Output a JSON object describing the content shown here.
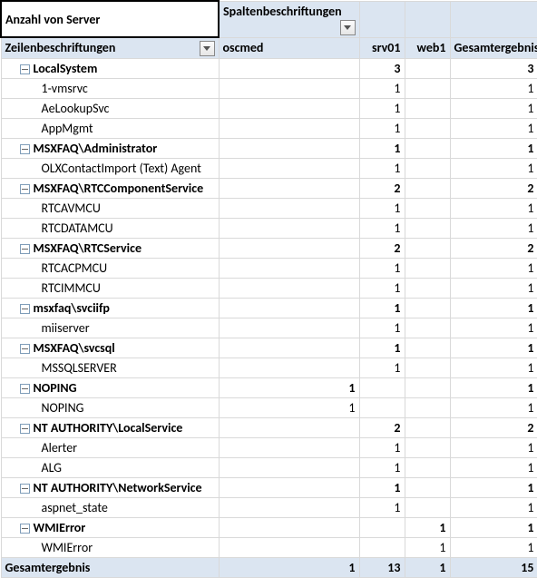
{
  "header": {
    "value_field": "Anzahl von Server",
    "col_labels": "Spaltenbeschriftungen",
    "row_labels": "Zeilenbeschriftungen",
    "grand_total": "Gesamtergebnis"
  },
  "columns": [
    "oscmed",
    "srv01",
    "web1",
    "Gesamtergebnis"
  ],
  "rows": [
    {
      "lvl": 1,
      "expand": true,
      "bold": true,
      "label": "LocalSystem",
      "v": [
        "",
        "3",
        "",
        "3"
      ]
    },
    {
      "lvl": 2,
      "label": "1-vmsrvc",
      "v": [
        "",
        "1",
        "",
        "1"
      ]
    },
    {
      "lvl": 2,
      "label": "AeLookupSvc",
      "v": [
        "",
        "1",
        "",
        "1"
      ]
    },
    {
      "lvl": 2,
      "label": "AppMgmt",
      "v": [
        "",
        "1",
        "",
        "1"
      ]
    },
    {
      "lvl": 1,
      "expand": true,
      "bold": true,
      "label": "MSXFAQ\\Administrator",
      "v": [
        "",
        "1",
        "",
        "1"
      ]
    },
    {
      "lvl": 2,
      "label": "OLXContactImport (Text) Agent",
      "v": [
        "",
        "1",
        "",
        "1"
      ]
    },
    {
      "lvl": 1,
      "expand": true,
      "bold": true,
      "label": "MSXFAQ\\RTCComponentService",
      "v": [
        "",
        "2",
        "",
        "2"
      ]
    },
    {
      "lvl": 2,
      "label": "RTCAVMCU",
      "v": [
        "",
        "1",
        "",
        "1"
      ]
    },
    {
      "lvl": 2,
      "label": "RTCDATAMCU",
      "v": [
        "",
        "1",
        "",
        "1"
      ]
    },
    {
      "lvl": 1,
      "expand": true,
      "bold": true,
      "label": "MSXFAQ\\RTCService",
      "v": [
        "",
        "2",
        "",
        "2"
      ]
    },
    {
      "lvl": 2,
      "label": "RTCACPMCU",
      "v": [
        "",
        "1",
        "",
        "1"
      ]
    },
    {
      "lvl": 2,
      "label": "RTCIMMCU",
      "v": [
        "",
        "1",
        "",
        "1"
      ]
    },
    {
      "lvl": 1,
      "expand": true,
      "bold": true,
      "label": "msxfaq\\svciifp",
      "v": [
        "",
        "1",
        "",
        "1"
      ]
    },
    {
      "lvl": 2,
      "label": "miiserver",
      "v": [
        "",
        "1",
        "",
        "1"
      ]
    },
    {
      "lvl": 1,
      "expand": true,
      "bold": true,
      "label": "MSXFAQ\\svcsql",
      "v": [
        "",
        "1",
        "",
        "1"
      ]
    },
    {
      "lvl": 2,
      "label": "MSSQLSERVER",
      "v": [
        "",
        "1",
        "",
        "1"
      ]
    },
    {
      "lvl": 1,
      "expand": true,
      "bold": true,
      "label": "NOPING",
      "v": [
        "1",
        "",
        "",
        "1"
      ]
    },
    {
      "lvl": 2,
      "label": "NOPING",
      "v": [
        "1",
        "",
        "",
        "1"
      ]
    },
    {
      "lvl": 1,
      "expand": true,
      "bold": true,
      "label": "NT AUTHORITY\\LocalService",
      "v": [
        "",
        "2",
        "",
        "2"
      ]
    },
    {
      "lvl": 2,
      "label": "Alerter",
      "v": [
        "",
        "1",
        "",
        "1"
      ]
    },
    {
      "lvl": 2,
      "label": "ALG",
      "v": [
        "",
        "1",
        "",
        "1"
      ]
    },
    {
      "lvl": 1,
      "expand": true,
      "bold": true,
      "label": "NT AUTHORITY\\NetworkService",
      "v": [
        "",
        "1",
        "",
        "1"
      ]
    },
    {
      "lvl": 2,
      "label": "aspnet_state",
      "v": [
        "",
        "1",
        "",
        "1"
      ]
    },
    {
      "lvl": 1,
      "expand": true,
      "bold": true,
      "label": "WMIError",
      "v": [
        "",
        "",
        "1",
        "1"
      ]
    },
    {
      "lvl": 2,
      "label": "WMIError",
      "v": [
        "",
        "",
        "1",
        "1"
      ]
    }
  ],
  "footer": {
    "label": "Gesamtergebnis",
    "v": [
      "1",
      "13",
      "1",
      "15"
    ]
  }
}
